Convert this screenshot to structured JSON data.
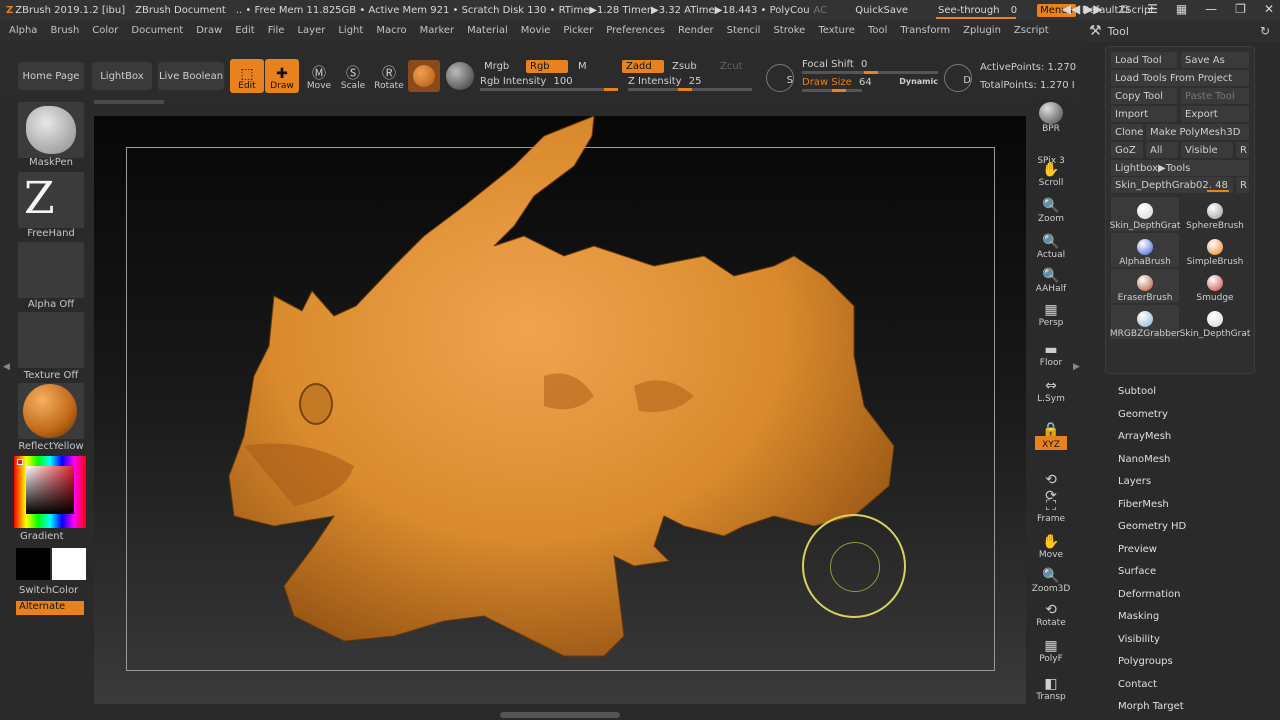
{
  "titlebar": {
    "app": "ZBrush 2019.1.2 [ibu]",
    "document": "ZBrush Document",
    "stats": "..  • Free Mem 11.825GB • Active Mem 921 • Scratch Disk 130 •  RTime▶1.28 Timer▶3.32 ATime▶18.443 • PolyCou",
    "ac": "AC",
    "quicksave": "QuickSave",
    "seethrough": "See-through",
    "seethrough_value": "0",
    "menus": "Menus",
    "script": "DefaultZScript"
  },
  "menu": [
    "Alpha",
    "Brush",
    "Color",
    "Document",
    "Draw",
    "Edit",
    "File",
    "Layer",
    "Light",
    "Macro",
    "Marker",
    "Material",
    "Movie",
    "Picker",
    "Preferences",
    "Render",
    "Stencil",
    "Stroke",
    "Texture",
    "Tool",
    "Transform",
    "Zplugin",
    "Zscript"
  ],
  "tool_header": {
    "title": "Tool"
  },
  "shelf": {
    "home": "Home Page",
    "lightbox": "LightBox",
    "liveboolean": "Live Boolean",
    "edit": "Edit",
    "draw": "Draw",
    "move": "Move",
    "scale": "Scale",
    "rotate": "Rotate",
    "mrgb": "Mrgb",
    "rgb": "Rgb",
    "m": "M",
    "rgb_intensity_label": "Rgb Intensity",
    "rgb_intensity": "100",
    "zadd": "Zadd",
    "zsub": "Zsub",
    "zcut": "Zcut",
    "z_intensity_label": "Z Intensity",
    "z_intensity": "25",
    "s_key": "S",
    "focal_label": "Focal Shift",
    "focal_value": "0",
    "drawsize_label": "Draw Size",
    "drawsize_value": "64",
    "dynamic": "Dynamic",
    "d_key": "D",
    "active_points": "ActivePoints: 1.270",
    "total_points": "TotalPoints: 1.270 I"
  },
  "left_tray": {
    "maskpen": "MaskPen",
    "freehand": "FreeHand",
    "alpha": "Alpha Off",
    "texture": "Texture Off",
    "material": "ReflectYellow",
    "gradient": "Gradient",
    "switchcolor": "SwitchColor",
    "alternate": "Alternate"
  },
  "right_bar": [
    {
      "name": "bpr",
      "label": "BPR",
      "icon": "sphere"
    },
    {
      "name": "spix",
      "label": "SPix 3",
      "icon": ""
    },
    {
      "name": "scroll",
      "label": "Scroll",
      "icon": "✋"
    },
    {
      "name": "zoom",
      "label": "Zoom",
      "icon": "🔍"
    },
    {
      "name": "actual",
      "label": "Actual",
      "icon": "🔍"
    },
    {
      "name": "aahalf",
      "label": "AAHalf",
      "icon": "🔍"
    },
    {
      "name": "persp",
      "label": "Persp",
      "icon": "▦"
    },
    {
      "name": "floor",
      "label": "Floor",
      "icon": "▬"
    },
    {
      "name": "lsym",
      "label": "L.Sym",
      "icon": "⇔"
    },
    {
      "name": "lock",
      "label": "",
      "icon": "🔒"
    },
    {
      "name": "xyz",
      "label": "XYZ",
      "icon": ""
    },
    {
      "name": "rot1",
      "label": "",
      "icon": "⟲"
    },
    {
      "name": "rot2",
      "label": "",
      "icon": "⟳"
    },
    {
      "name": "frame",
      "label": "Frame",
      "icon": "⛶"
    },
    {
      "name": "move",
      "label": "Move",
      "icon": "✋"
    },
    {
      "name": "zoom3d",
      "label": "Zoom3D",
      "icon": "🔍"
    },
    {
      "name": "rotate",
      "label": "Rotate",
      "icon": "⟲"
    },
    {
      "name": "polyf",
      "label": "PolyF",
      "icon": "▦"
    },
    {
      "name": "transp",
      "label": "Transp",
      "icon": "◧"
    }
  ],
  "tool_panel": {
    "load_tool": "Load Tool",
    "save_as": "Save As",
    "load_from_project": "Load Tools From Project",
    "copy_tool": "Copy Tool",
    "paste_tool": "Paste Tool",
    "import": "Import",
    "export": "Export",
    "clone": "Clone",
    "make_polymesh": "Make PolyMesh3D",
    "goz": "GoZ",
    "all": "All",
    "visible": "Visible",
    "r": "R",
    "lightbox_tools": "Lightbox▶Tools",
    "current_tool": "Skin_DepthGrab02. 48",
    "brushes": [
      {
        "label": "Skin_DepthGrat",
        "color": "#d8d8d8"
      },
      {
        "label": "SphereBrush",
        "color": "#9a9a9a"
      },
      {
        "label": "AlphaBrush",
        "color": "#3a5fd8"
      },
      {
        "label": "SimpleBrush",
        "color": "#e8821e"
      },
      {
        "label": "EraserBrush",
        "color": "#b0502c"
      },
      {
        "label": "Smudge",
        "color": "#c84040"
      },
      {
        "label": "MRGBZGrabber",
        "color": "#8ab0d8"
      },
      {
        "label": "Skin_DepthGrat",
        "color": "#d8d8d8"
      }
    ]
  },
  "subpalettes": [
    "Subtool",
    "Geometry",
    "ArrayMesh",
    "NanoMesh",
    "Layers",
    "FiberMesh",
    "Geometry HD",
    "Preview",
    "Surface",
    "Deformation",
    "Masking",
    "Visibility",
    "Polygroups",
    "Contact",
    "Morph Target"
  ],
  "colors": {
    "accent": "#e8821e",
    "model": "#d98a2c",
    "cursor": "#d8d060"
  }
}
